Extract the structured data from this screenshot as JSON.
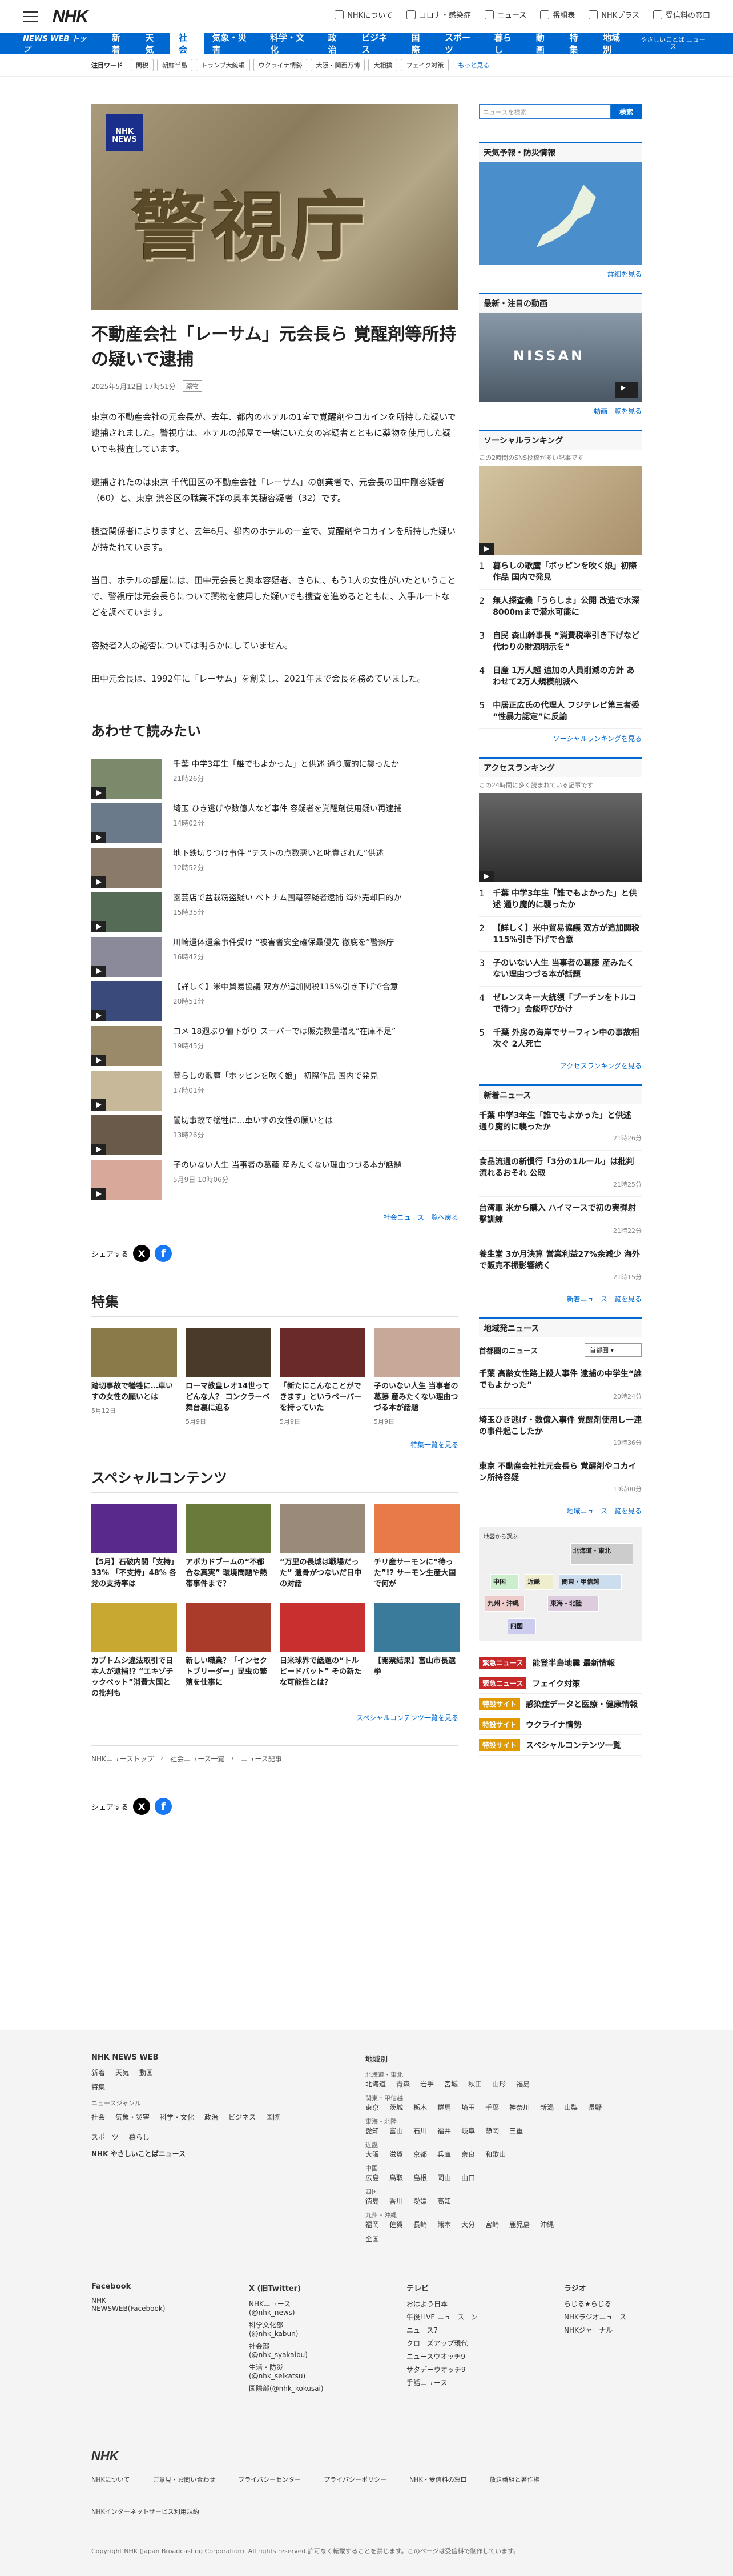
{
  "header": {
    "logo": "NHK",
    "links": [
      "NHKについて",
      "コロナ・感染症",
      "ニュース",
      "番組表",
      "NHKプラス",
      "受信料の窓口"
    ]
  },
  "nav": {
    "brand": "NEWS WEB トップ",
    "items": [
      "新着",
      "天気",
      "社会",
      "気象・災害",
      "科学・文化",
      "政治",
      "ビジネス",
      "国際",
      "スポーツ",
      "暮らし",
      "動画",
      "特集",
      "地域別"
    ],
    "active": "社会",
    "yasashii": "やさしいことば ニュース"
  },
  "tags": {
    "label": "注目ワード",
    "items": [
      "関税",
      "朝鮮半島",
      "トランプ大統領",
      "ウクライナ情勢",
      "大阪・関西万博",
      "大相撲",
      "フェイク対策"
    ],
    "more": "もっと見る"
  },
  "article": {
    "hero_text": "警視庁",
    "badge": "NHK NEWS",
    "title": "不動産会社「レーサム」元会長ら 覚醒剤等所持の疑いで逮捕",
    "date": "2025年5月12日 17時51分",
    "category": "薬物",
    "paragraphs": [
      "東京の不動産会社の元会長が、去年、都内のホテルの1室で覚醒剤やコカインを所持した疑いで逮捕されました。警視庁は、ホテルの部屋で一緒にいた女の容疑者とともに薬物を使用した疑いでも捜査しています。",
      "逮捕されたのは東京 千代田区の不動産会社「レーサム」の創業者で、元会長の田中剛容疑者（60）と、東京 渋谷区の職業不詳の奥本美穂容疑者（32）です。",
      "捜査関係者によりますと、去年6月、都内のホテルの一室で、覚醒剤やコカインを所持した疑いが持たれています。",
      "当日、ホテルの部屋には、田中元会長と奥本容疑者、さらに、もう1人の女性がいたということで、警視庁は元会長らについて薬物を使用した疑いでも捜査を進めるとともに、入手ルートなどを調べています。",
      "容疑者2人の認否については明らかにしていません。",
      "田中元会長は、1992年に「レーサム」を創業し、2021年まで会長を務めていました。"
    ]
  },
  "related": {
    "heading": "あわせて読みたい",
    "items": [
      {
        "title": "千葉 中学3年生「誰でもよかった」と供述 通り魔的に襲ったか",
        "time": "21時26分"
      },
      {
        "title": "埼玉 ひき逃げや数億人など事件 容疑者を覚醒剤使用疑い再逮捕",
        "time": "14時02分"
      },
      {
        "title": "地下鉄切りつけ事件 “テストの点数悪いと叱責された”供述",
        "time": "12時52分"
      },
      {
        "title": "園芸店で盆栽窃盗疑い ベトナム国籍容疑者逮捕 海外売却目的か",
        "time": "15時35分"
      },
      {
        "title": "川崎遺体遺棄事件受け “被害者安全確保最優先 徹底を”警察庁",
        "time": "16時42分"
      },
      {
        "title": "【詳しく】米中貿易協議 双方が追加関税115%引き下げで合意",
        "time": "20時51分"
      },
      {
        "title": "コメ 18週ぶり値下がり スーパーでは販売数量増え“在庫不足”",
        "time": "19時45分"
      },
      {
        "title": "暮らしの歌麿「ポッピンを吹く娘」 初際作品 国内で発見",
        "time": "17時01分"
      },
      {
        "title": "闇切事故で犠牲に…車いすの女性の願いとは",
        "time": "13時26分"
      },
      {
        "title": "子のいない人生 当事者の葛藤 産みたくない理由つづる本が話題",
        "time": "5月9日 10時06分"
      }
    ],
    "more": "社会ニュース一覧へ戻る"
  },
  "share": {
    "label": "シェアする"
  },
  "features": {
    "heading": "特集",
    "items": [
      {
        "title": "踏切事故で犠牲に…車いすの女性の願いとは",
        "date": "5月12日"
      },
      {
        "title": "ローマ教皇レオ14世ってどんな人？ コンクラーベ舞台裏に迫る",
        "date": "5月9日"
      },
      {
        "title": "「新たにこんなことができます」というペーパーを持っていた",
        "date": "5月9日"
      },
      {
        "title": "子のいない人生 当事者の葛藤 産みたくない理由つづる本が話題",
        "date": "5月9日"
      }
    ],
    "more": "特集一覧を見る"
  },
  "special": {
    "heading": "スペシャルコンテンツ",
    "items": [
      "【5月】石破内閣「支持」33% 「不支持」48% 各党の支持率は",
      "アボカドブームの“不都合な真実” 環境問題や熱帯事件まで？",
      "“万里の長城は戦場だった” 遺骨がつないだ日中の対話",
      "チリ産サーモンに“待った”!? サーモン生産大国で何が",
      "カブトムシ違法取引で日本人が逮捕!? “エキゾチックペット”消費大国との批判も",
      "新しい職業？「インセクトブリーダー」昆虫の繁殖を仕事に",
      "日米球界で話題の“トルピードバット” その新たな可能性とは？",
      "【開票結果】富山市長選挙"
    ],
    "more": "スペシャルコンテンツ一覧を見る"
  },
  "breadcrumb": [
    "NHKニューストップ",
    "社会ニュース一覧",
    "ニュース記事"
  ],
  "sidebar": {
    "search_placeholder": "ニュースを検索",
    "search_button": "検索",
    "weather": {
      "heading": "天気予報・防災情報",
      "more": "詳細を見る"
    },
    "video": {
      "heading": "最新・注目の動画",
      "more": "動画一覧を見る",
      "banner": "NISSAN"
    },
    "social": {
      "heading": "ソーシャルランキング",
      "sub": "この2時間のSNS投稿が多い記事です",
      "items": [
        "暮らしの歌麿「ポッピンを吹く娘」初際作品 国内で発見",
        "無人探査機「うらしま」公開 改造で水深8000mまで潜水可能に",
        "自民 森山幹事長 “消費税率引き下げなど代わりの財源明示を”",
        "日産 1万人超 追加の人員削減の方針 あわせて2万人規模削減へ",
        "中居正広氏の代理人 フジテレビ第三者委 “性暴力認定”に反論"
      ],
      "more": "ソーシャルランキングを見る"
    },
    "access": {
      "heading": "アクセスランキング",
      "sub": "この24時間に多く読まれている記事です",
      "items": [
        "千葉 中学3年生「誰でもよかった」と供述 通り魔的に襲ったか",
        "【詳しく】米中貿易協議 双方が追加関税115%引き下げで合意",
        "子のいない人生 当事者の葛藤 産みたくない理由つづる本が話題",
        "ゼレンスキー大統領「プーチンをトルコで待つ」会談呼びかけ",
        "千葉 外房の海岸でサーフィン中の事故相次ぐ 2人死亡"
      ],
      "more": "アクセスランキングを見る"
    },
    "newest": {
      "heading": "新着ニュース",
      "items": [
        {
          "title": "千葉 中学3年生「誰でもよかった」と供述 通り魔的に襲ったか",
          "time": "21時26分"
        },
        {
          "title": "食品流通の新慣行「3分の1ルール」は批判流れるおそれ 公取",
          "time": "21時25分"
        },
        {
          "title": "台湾軍 米から購入 ハイマースで初の実弾射撃訓練",
          "time": "21時22分"
        },
        {
          "title": "養生堂 3か月決算 営業利益27%余減少 海外で販売不振影響続く",
          "time": "21時15分"
        }
      ],
      "more": "新着ニュース一覧を見る"
    },
    "regional": {
      "heading": "地域発ニュース",
      "sub": "首都圏のニュース",
      "select": "首都圏",
      "items": [
        {
          "title": "千葉 高齢女性路上殺人事件 逮捕の中学生“誰でもよかった”",
          "time": "20時24分"
        },
        {
          "title": "埼玉ひき逃げ・数億入事件 覚醒剤使用し一連の事件起こしたか",
          "time": "19時36分"
        },
        {
          "title": "東京 不動産会社社元会長ら 覚醒剤やコカイン所持容疑",
          "time": "19時00分"
        }
      ],
      "more": "地域ニュース一覧を見る"
    },
    "map": {
      "label": "地図から選ぶ",
      "regions": [
        "北海道・東北",
        "関東・甲信越",
        "東海・北陸",
        "近畿",
        "中国",
        "九州・沖縄",
        "四国"
      ]
    },
    "banners": [
      {
        "tag": "緊急ニュース",
        "text": "能登半島地震 最新情報",
        "color": "#c62828"
      },
      {
        "tag": "緊急ニュース",
        "text": "フェイク対策",
        "color": "#c62828"
      },
      {
        "tag": "特設サイト",
        "text": "感染症データと医療・健康情報",
        "color": "#e09a00"
      },
      {
        "tag": "特設サイト",
        "text": "ウクライナ情勢",
        "color": "#e09a00"
      },
      {
        "tag": "特設サイト",
        "text": "スペシャルコンテンツ一覧",
        "color": "#e09a00"
      }
    ]
  },
  "footer": {
    "title": "NHK NEWS WEB",
    "links1": [
      "新着",
      "天気",
      "動画"
    ],
    "link2": "特集",
    "genre_label": "ニュースジャンル",
    "genres": [
      "社会",
      "気象・災害",
      "科学・文化",
      "政治",
      "ビジネス",
      "国際",
      "スポーツ",
      "暮らし"
    ],
    "yasashii": "NHK やさしいことばニュース",
    "region_title": "地域別",
    "regions": [
      {
        "label": "北海道・東北",
        "items": [
          "北海道",
          "青森",
          "岩手",
          "宮城",
          "秋田",
          "山形",
          "福島"
        ]
      },
      {
        "label": "関東・甲信越",
        "items": [
          "東京",
          "茨城",
          "栃木",
          "群馬",
          "埼玉",
          "千葉",
          "神奈川",
          "新潟",
          "山梨",
          "長野"
        ]
      },
      {
        "label": "東海・北陸",
        "items": [
          "愛知",
          "富山",
          "石川",
          "福井",
          "岐阜",
          "静岡",
          "三重"
        ]
      },
      {
        "label": "近畿",
        "items": [
          "大阪",
          "滋賀",
          "京都",
          "兵庫",
          "奈良",
          "和歌山"
        ]
      },
      {
        "label": "中国",
        "items": [
          "広島",
          "鳥取",
          "島根",
          "岡山",
          "山口"
        ]
      },
      {
        "label": "四国",
        "items": [
          "徳島",
          "香川",
          "愛媛",
          "高知"
        ]
      },
      {
        "label": "九州・沖縄",
        "items": [
          "福岡",
          "佐賀",
          "長崎",
          "熊本",
          "大分",
          "宮崎",
          "鹿児島",
          "沖縄"
        ]
      }
    ],
    "zenkoku": "全国",
    "sns": {
      "facebook_label": "Facebook",
      "facebook": [
        "NHK NEWSWEB(Facebook)"
      ],
      "x_label": "X (旧Twitter)",
      "x": [
        "NHKニュース(@nhk_news)",
        "科学文化部(@nhk_kabun)",
        "社会部(@nhk_syakaibu)",
        "生活・防災(@nhk_seikatsu)",
        "国際部(@nhk_kokusai)"
      ],
      "tv_label": "テレビ",
      "tv": [
        "おはよう日本",
        "午後LIVE ニュースーン",
        "ニュース7",
        "クローズアップ現代",
        "ニュースウオッチ9",
        "サタデーウオッチ9",
        "手話ニュース"
      ],
      "radio_label": "ラジオ",
      "radio": [
        "らじる★らじる",
        "NHKラジオニュース",
        "NHKジャーナル"
      ]
    },
    "logo": "NHK",
    "bottom": [
      "NHKについて",
      "ご意見・お問い合わせ",
      "プライバシーセンター",
      "プライバシーポリシー",
      "NHK・受信料の窓口",
      "放送番組と著作権",
      "NHKインターネットサービス利用規約"
    ],
    "copyright": "Copyright NHK (Japan Broadcasting Corporation). All rights reserved.許可なく転載することを禁じます。このページは受信料で制作しています。"
  }
}
